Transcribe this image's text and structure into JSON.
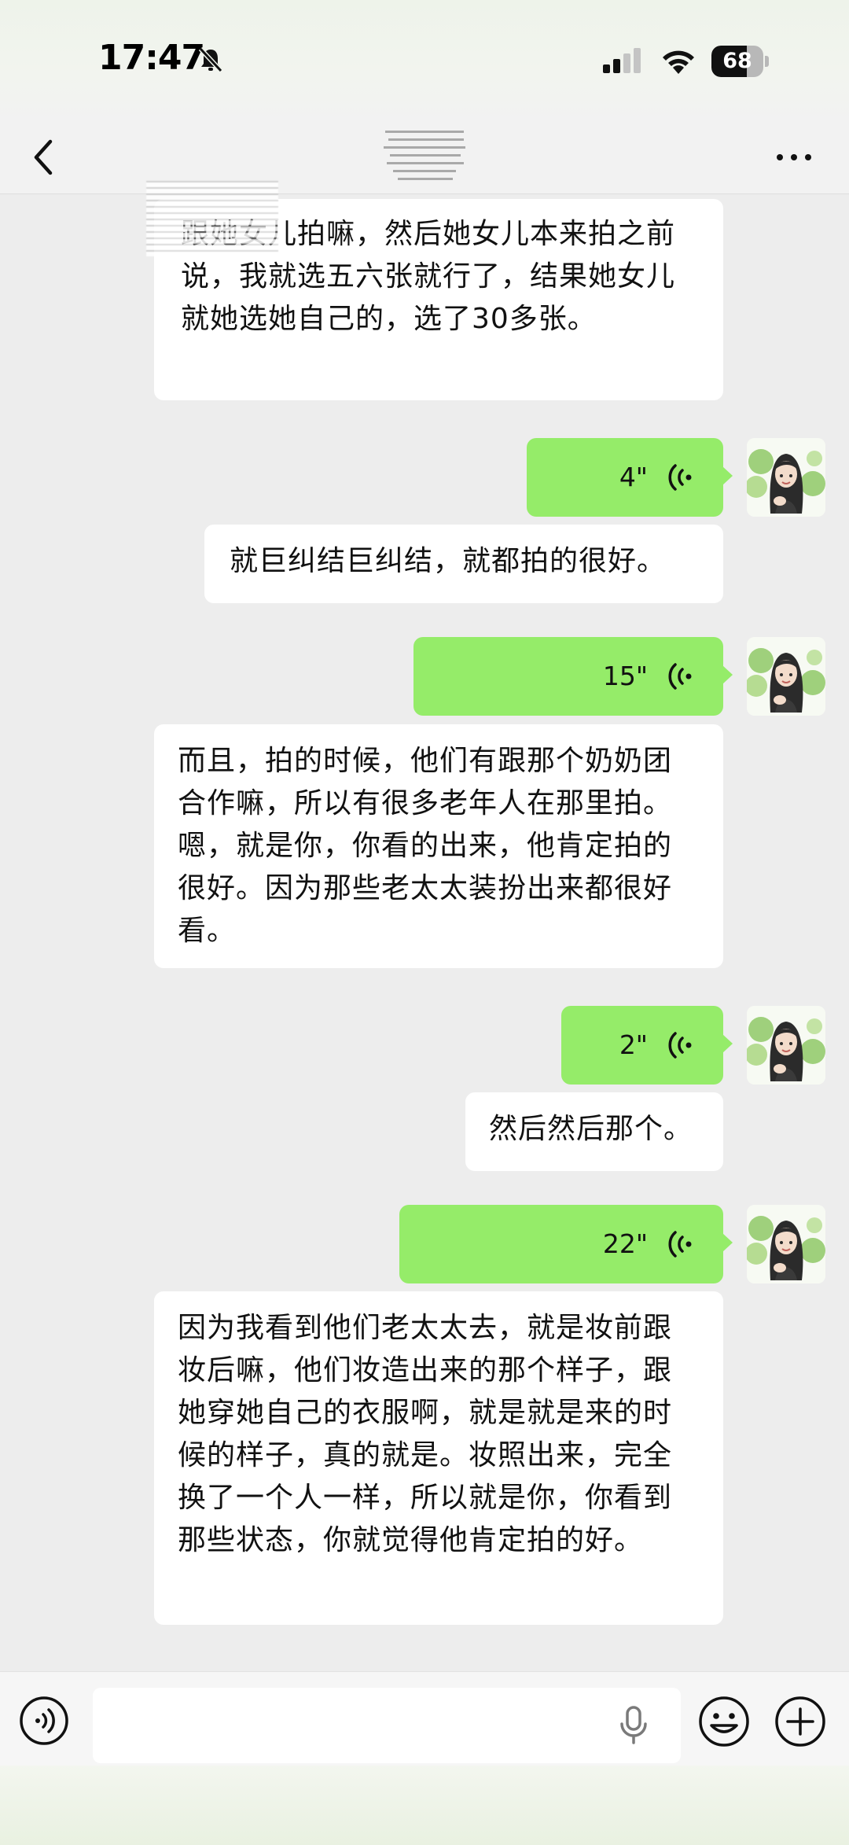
{
  "status_bar": {
    "time": "17:47",
    "battery_level": "68",
    "battery_fraction": 0.68
  },
  "nav": {
    "back_icon": "chevron-left-icon",
    "more_icon": "ellipsis-icon"
  },
  "messages": [
    {
      "type": "text",
      "side": "left",
      "text": "跟她女儿拍嘛，然后她女儿本来拍之前说，我就选五六张就行了，结果她女儿就她选她自己的，选了30多张。"
    },
    {
      "type": "voice",
      "side": "right",
      "duration": "4\""
    },
    {
      "type": "text",
      "side": "left",
      "text": "就巨纠结巨纠结，就都拍的很好。"
    },
    {
      "type": "voice",
      "side": "right",
      "duration": "15\""
    },
    {
      "type": "text",
      "side": "left",
      "text": "而且，拍的时候，他们有跟那个奶奶团合作嘛，所以有很多老年人在那里拍。嗯，就是你，你看的出来，他肯定拍的很好。因为那些老太太装扮出来都很好看。"
    },
    {
      "type": "voice",
      "side": "right",
      "duration": "2\""
    },
    {
      "type": "text",
      "side": "left",
      "text": "然后然后那个。"
    },
    {
      "type": "voice",
      "side": "right",
      "duration": "22\""
    },
    {
      "type": "text",
      "side": "left",
      "text": "因为我看到他们老太太去，就是妆前跟妆后嘛，他们妆造出来的那个样子，跟她穿她自己的衣服啊，就是就是来的时候的样子，真的就是。妆照出来，完全换了一个人一样，所以就是你，你看到那些状态，你就觉得他肯定拍的好。"
    }
  ],
  "input_bar": {
    "voice_toggle_icon": "voice-mode-icon",
    "input_value": "",
    "mic_icon": "microphone-icon",
    "emoji_icon": "emoji-icon",
    "plus_icon": "plus-icon"
  },
  "colors": {
    "chat_background": "#ededed",
    "incoming_bubble": "#ffffff",
    "outgoing_bubble": "#95ec69"
  }
}
